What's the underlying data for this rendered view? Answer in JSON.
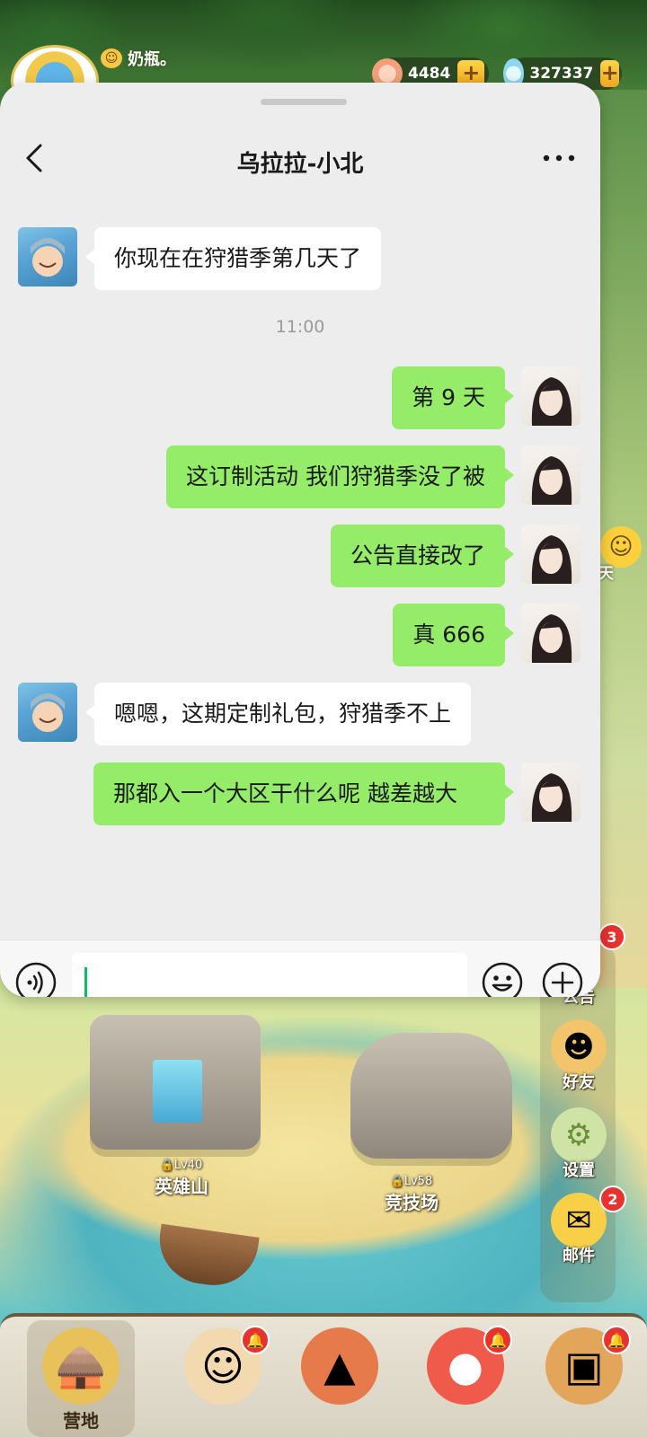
{
  "hud": {
    "player_name": "奶瓶。",
    "resources": [
      {
        "name": "shell-currency",
        "value": "4484"
      },
      {
        "name": "gem-currency",
        "value": "327337"
      }
    ],
    "plus_label": "+"
  },
  "chat": {
    "title": "乌拉拉-小北",
    "messages": [
      {
        "from": "friend",
        "text": "你现在在狩猎季第几天了"
      },
      {
        "from": "time",
        "text": "11:00"
      },
      {
        "from": "self",
        "text": "第 9 天"
      },
      {
        "from": "self",
        "text": "这订制活动  我们狩猎季没了被"
      },
      {
        "from": "self",
        "text": "公告直接改了"
      },
      {
        "from": "self",
        "text": "真 666"
      },
      {
        "from": "friend",
        "text": "嗯嗯，这期定制礼包，狩猎季不上"
      },
      {
        "from": "self",
        "text": "那都入一个大区干什么呢  越差越大"
      }
    ],
    "input": {
      "value": "",
      "placeholder": ""
    }
  },
  "map": {
    "hero_mountain": {
      "label": "英雄山",
      "level": "Lv40"
    },
    "arena": {
      "label": "竞技场",
      "level": "Lv58"
    }
  },
  "side_menu": {
    "peek_label": "天",
    "items": [
      {
        "label": "公告",
        "badge": "3"
      },
      {
        "label": "好友",
        "badge": ""
      },
      {
        "label": "设置",
        "badge": ""
      },
      {
        "label": "邮件",
        "badge": "2"
      }
    ]
  },
  "bottom_nav": {
    "items": [
      {
        "label": "营地",
        "active": true
      }
    ]
  },
  "colors": {
    "self_bubble": "#95ec69",
    "friend_bubble": "#ffffff",
    "badge_red": "#e8322f",
    "caret_green": "#07c160"
  }
}
